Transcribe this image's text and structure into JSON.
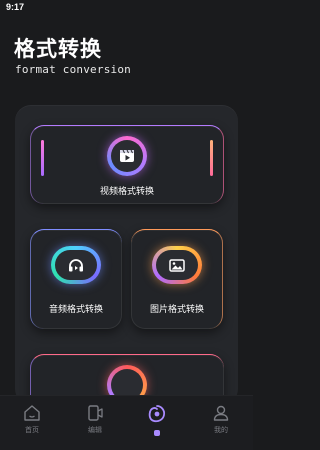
{
  "status_bar": {
    "time": "9:17"
  },
  "header": {
    "title": "格式转换",
    "subtitle": "format conversion"
  },
  "cards": {
    "video": {
      "label": "视频格式转换",
      "icon": "video-icon"
    },
    "audio": {
      "label": "音频格式转换",
      "icon": "headphones-icon"
    },
    "image": {
      "label": "图片格式转换",
      "icon": "image-icon"
    }
  },
  "tabbar": {
    "home": "首页",
    "edit": "编辑",
    "mine": "我的"
  },
  "colors": {
    "background": "#1a1b1d",
    "panel": "#25272b",
    "accent": "#a98bff"
  }
}
